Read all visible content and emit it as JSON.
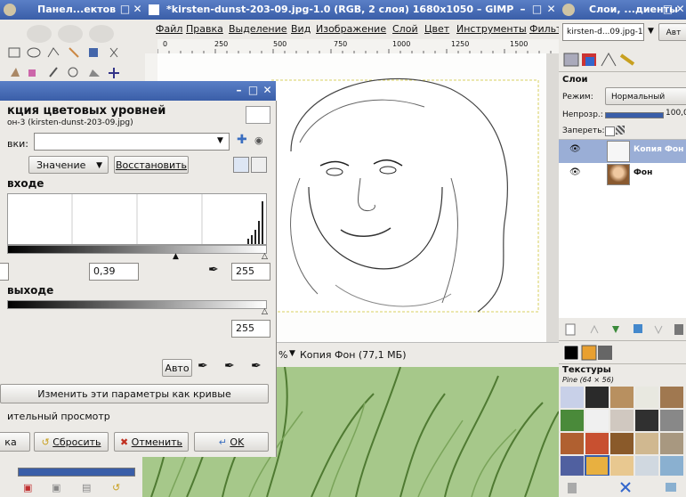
{
  "toolbox": {
    "title": "Панел...ектов"
  },
  "gimp": {
    "title": "*kirsten-dunst-203-09.jpg-1.0 (RGB, 2 слоя) 1680x1050 – GIMP",
    "menu": [
      "Файл",
      "Правка",
      "Выделение",
      "Вид",
      "Изображение",
      "Слой",
      "Цвет",
      "Инструменты",
      "Фильт"
    ],
    "ruler_ticks": [
      "0",
      "250",
      "500",
      "750",
      "1000",
      "1250",
      "1500"
    ],
    "status_zoom": "%",
    "status_layer": "Копия Фон (77,1 МБ)"
  },
  "levels": {
    "title": "Коррекция цветовых уровней",
    "heading": "кция цветовых уровней",
    "subtitle": "он-3 (kirsten-dunst-203-09.jpg)",
    "presets_label": "вки:",
    "channel_value": "Значение",
    "reset_channel": "Восстановить",
    "input_label": "входе",
    "input_gamma": "0,39",
    "input_high": "255",
    "output_label": "выходе",
    "output_high": "255",
    "auto": "Авто",
    "edit_curves": "Изменить эти параметры как кривые",
    "preview": "ительный просмотр",
    "help": "ка",
    "reset": "Сбросить",
    "cancel": "Отменить",
    "ok": "OK"
  },
  "layers_dock": {
    "title": "Слои, ...диенты",
    "image_select": "kirsten-d...09.jpg-1",
    "auto": "Авт",
    "tab_title": "Слои",
    "mode_label": "Режим:",
    "mode_value": "Нормальный",
    "opacity_label": "Непрозр.:",
    "opacity_value": "100,0",
    "lock_label": "Запереть:",
    "layers": [
      {
        "name": "Копия Фон",
        "selected": true
      },
      {
        "name": "Фон",
        "selected": false
      }
    ],
    "textures_title": "Текстуры",
    "texture_name": "Pine (64 × 56)"
  }
}
